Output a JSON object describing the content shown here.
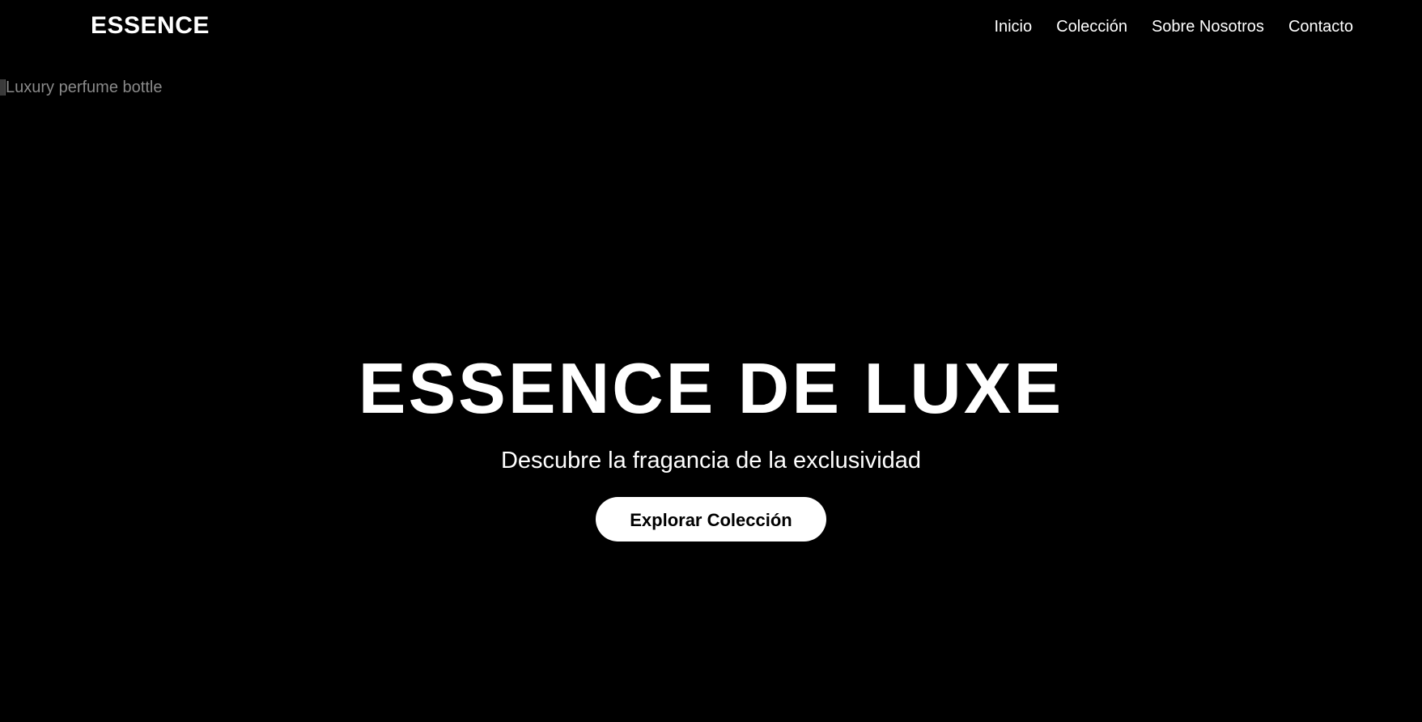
{
  "navbar": {
    "logo": "ESSENCE",
    "links": [
      {
        "label": "Inicio"
      },
      {
        "label": "Colección"
      },
      {
        "label": "Sobre Nosotros"
      },
      {
        "label": "Contacto"
      }
    ]
  },
  "hero": {
    "image_alt": "Luxury perfume bottle",
    "title": "ESSENCE DE LUXE",
    "subtitle": "Descubre la fragancia de la exclusividad",
    "cta_label": "Explorar Colección"
  },
  "colors": {
    "background": "#000000",
    "text": "#ffffff",
    "button_bg": "#ffffff",
    "button_text": "#000000",
    "alt_text": "#8a8a8a"
  }
}
